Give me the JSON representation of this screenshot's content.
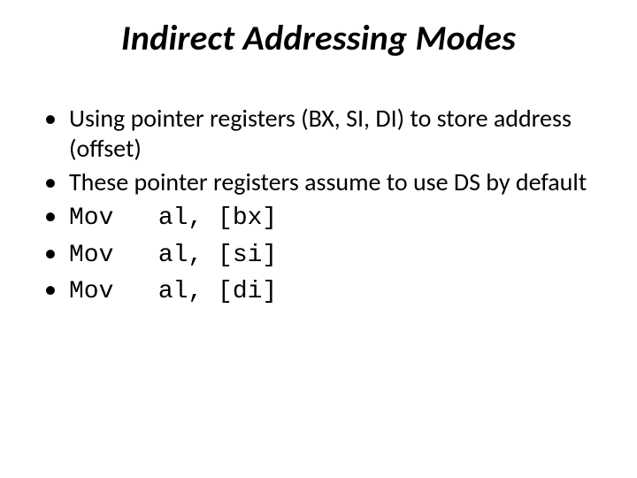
{
  "title": "Indirect Addressing Modes",
  "bullets": {
    "b0": "Using pointer registers (BX, SI, DI) to store address (offset)",
    "b1": "These pointer registers assume to use DS by default",
    "b2": "Mov   al, [bx]",
    "b3": "Mov   al, [si]",
    "b4": "Mov   al, [di]"
  }
}
